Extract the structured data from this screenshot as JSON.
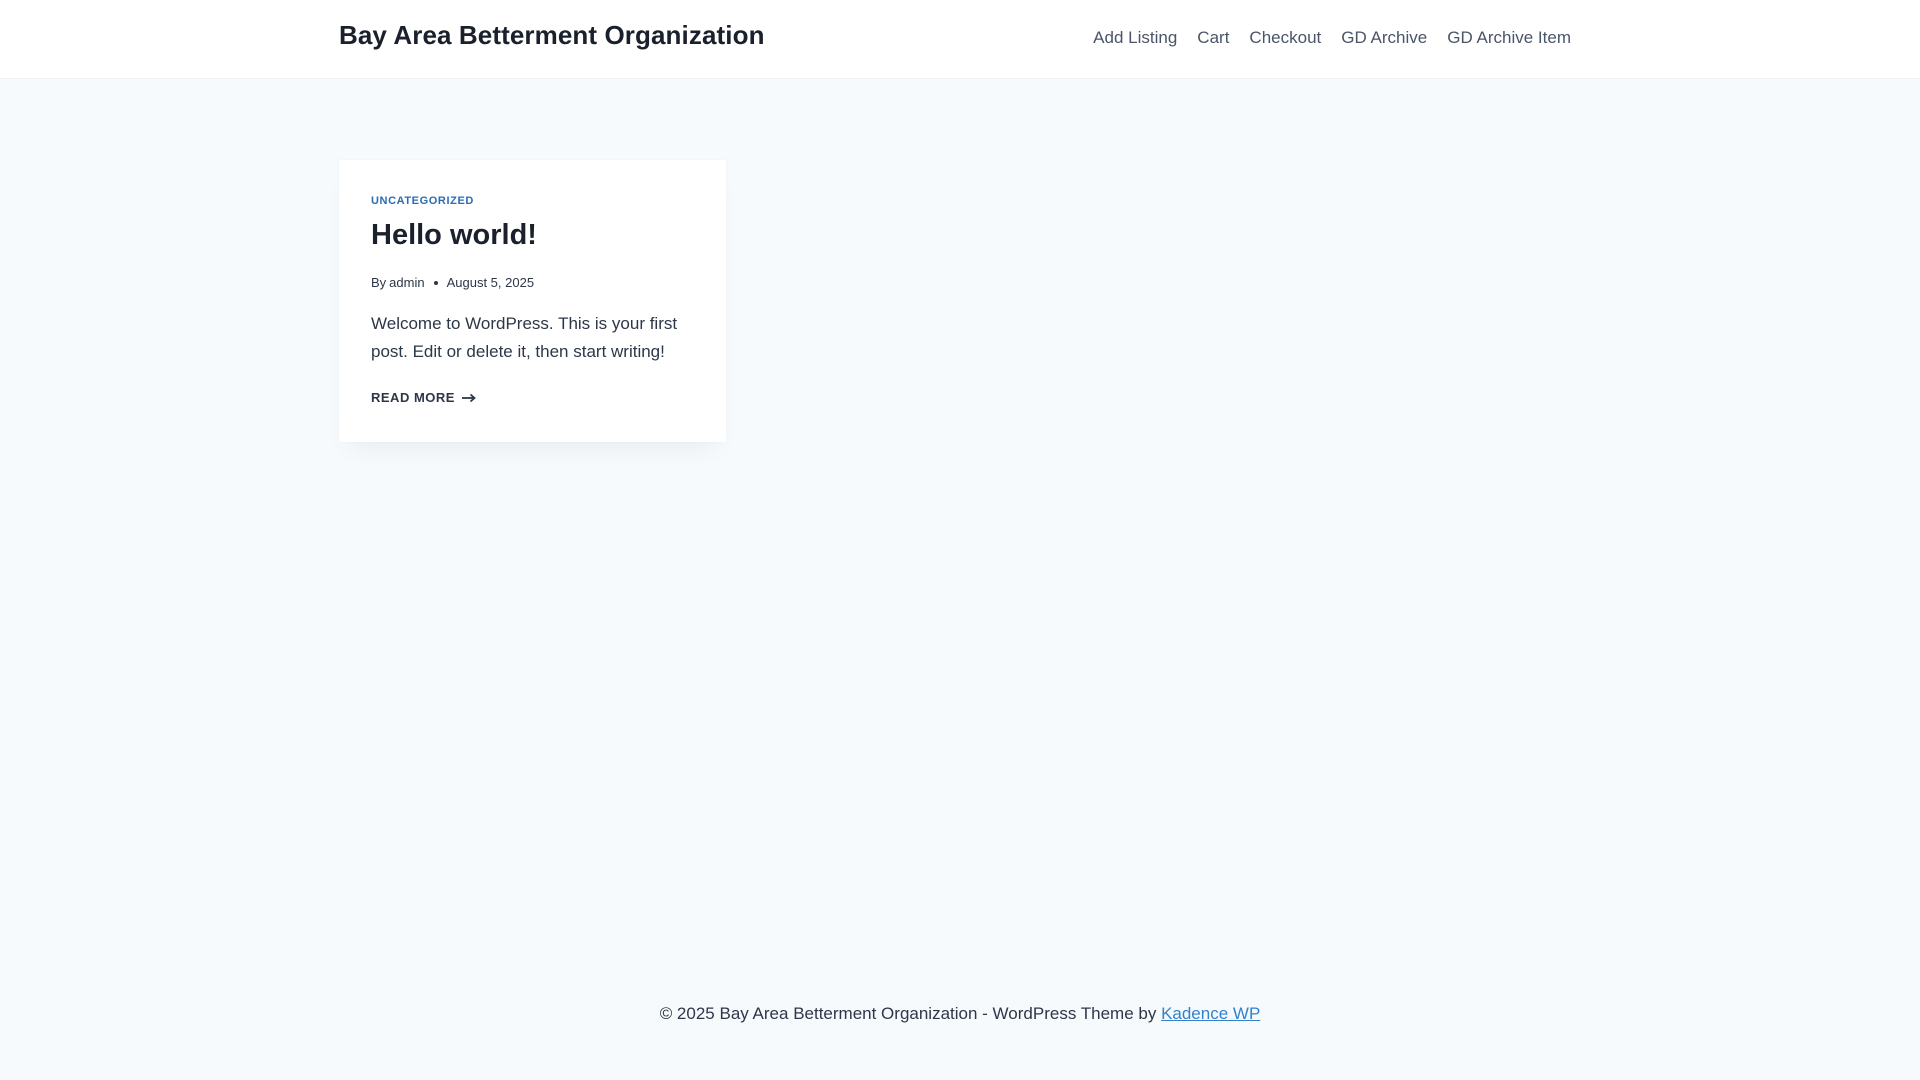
{
  "header": {
    "site_title": "Bay Area Betterment Organization",
    "nav": [
      {
        "label": "Add Listing"
      },
      {
        "label": "Cart"
      },
      {
        "label": "Checkout"
      },
      {
        "label": "GD Archive"
      },
      {
        "label": "GD Archive Item"
      }
    ]
  },
  "post": {
    "category": "UNCATEGORIZED",
    "title": "Hello world!",
    "by_label": "By",
    "author": "admin",
    "date": "August 5, 2025",
    "excerpt": "Welcome to WordPress. This is your first post. Edit or delete it, then start writing!",
    "read_more": "READ MORE",
    "read_more_icon": "arrow-right-icon"
  },
  "footer": {
    "text": "© 2025 Bay Area Betterment Organization - WordPress Theme by",
    "link_label": "Kadence WP"
  },
  "colors": {
    "background": "#f7fafc",
    "accent": "#2b6cb0",
    "link": "#3182ce",
    "heading": "#1a202c",
    "text": "#2d3748"
  }
}
